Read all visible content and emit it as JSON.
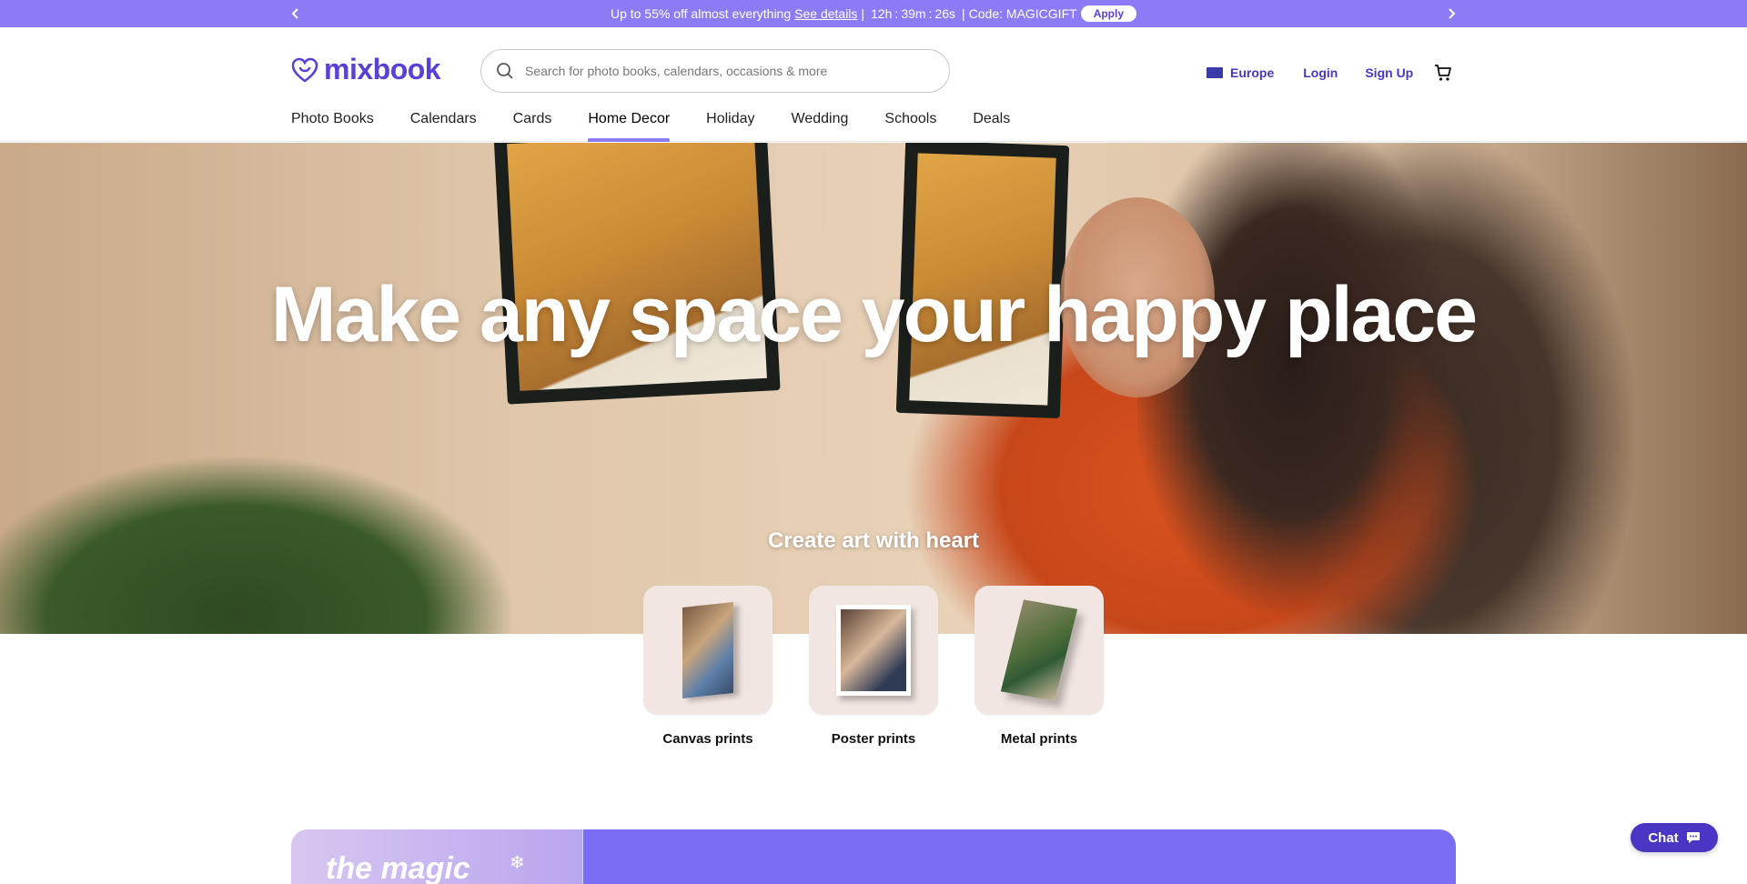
{
  "promo": {
    "text": "Up to 55% off almost everything",
    "details_link": "See details",
    "timer_hours": "12h",
    "timer_colon": ":",
    "timer_minutes": "39m",
    "timer_seconds": "26s",
    "code_text": "Code: MAGICGIFT",
    "apply_label": "Apply"
  },
  "header": {
    "logo_text": "mixbook",
    "search_placeholder": "Search for photo books, calendars, occasions & more",
    "region": "Europe",
    "login": "Login",
    "signup": "Sign Up"
  },
  "nav": {
    "items": [
      {
        "label": "Photo Books"
      },
      {
        "label": "Calendars"
      },
      {
        "label": "Cards"
      },
      {
        "label": "Home Decor",
        "active": true
      },
      {
        "label": "Holiday"
      },
      {
        "label": "Wedding"
      },
      {
        "label": "Schools"
      },
      {
        "label": "Deals"
      }
    ]
  },
  "hero": {
    "title": "Make any space your happy place",
    "subtitle": "Create art with heart"
  },
  "products": [
    {
      "label": "Canvas prints"
    },
    {
      "label": "Poster prints"
    },
    {
      "label": "Metal prints"
    }
  ],
  "banner": {
    "left_text": "the magic"
  },
  "chat": {
    "label": "Chat"
  },
  "colors": {
    "brand": "#5b3fd6",
    "promo_bg": "#8b7cf6",
    "chat_bg": "#4a36c4",
    "tile_bg": "#f1e6e1"
  }
}
